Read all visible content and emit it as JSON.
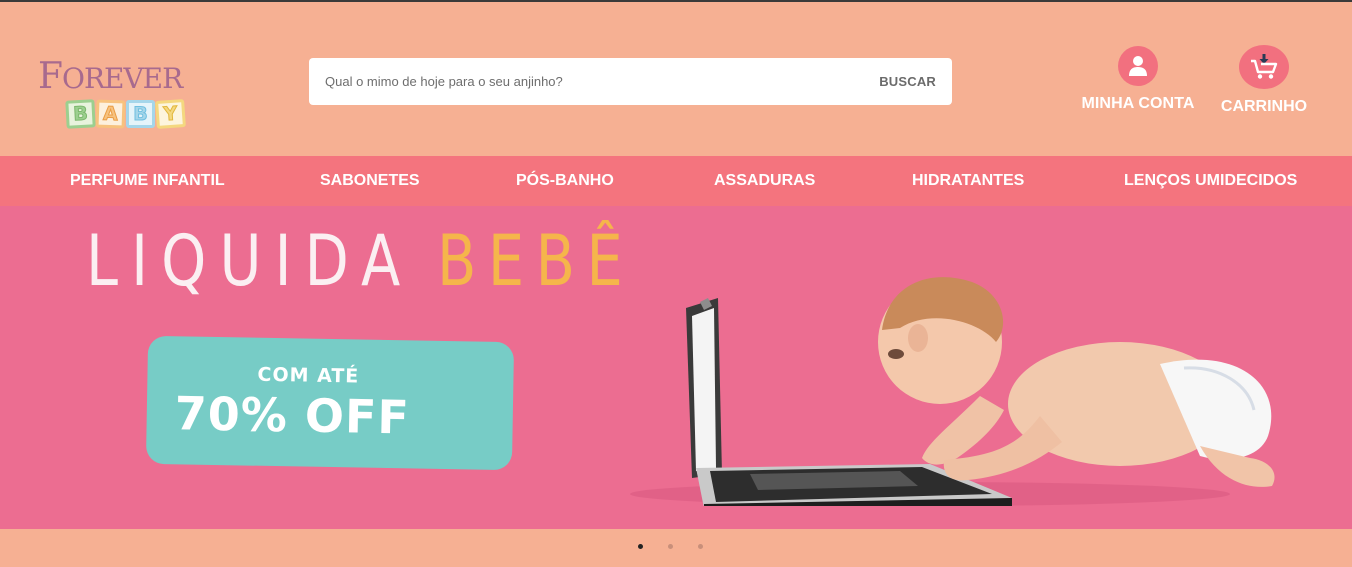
{
  "brand": {
    "logo_word": "FOREVER",
    "logo_blocks": [
      "B",
      "A",
      "B",
      "Y"
    ]
  },
  "search": {
    "placeholder": "Qual o mimo de hoje para o seu anjinho?",
    "button_label": "BUSCAR",
    "icon": "search-icon"
  },
  "header": {
    "account_label": "MINHA CONTA",
    "account_icon": "user-icon",
    "cart_label": "CARRINHO",
    "cart_icon": "cart-icon"
  },
  "nav": {
    "items": [
      {
        "label": "PERFUME INFANTIL"
      },
      {
        "label": "SABONETES"
      },
      {
        "label": "PÓS-BANHO"
      },
      {
        "label": "ASSADURAS"
      },
      {
        "label": "HIDRATANTES"
      },
      {
        "label": "LENÇOS UMIDECIDOS"
      }
    ]
  },
  "banner": {
    "headline_part1": "LIQUIDA",
    "headline_part2": "BEBÊ",
    "promo_small": "COM ATÉ",
    "promo_big": "70% OFF",
    "image": "baby-with-laptop"
  },
  "carousel": {
    "slides": 3,
    "active_index": 0
  },
  "colors": {
    "header_bg": "#f6b093",
    "nav_bg": "#f4747e",
    "banner_bg": "#ec6d91",
    "promo_bg": "#77ccc6",
    "accent_yellow": "#f5b54b"
  }
}
